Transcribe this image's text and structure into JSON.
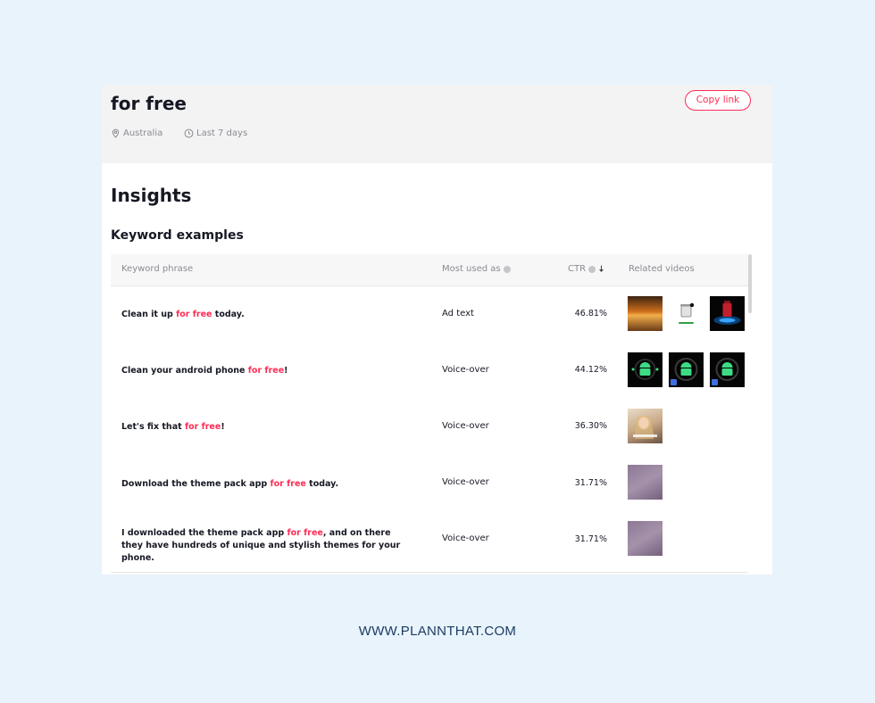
{
  "header": {
    "title": "for free",
    "copy_link_label": "Copy link",
    "location": "Australia",
    "period": "Last 7 days"
  },
  "insights": {
    "title": "Insights",
    "keyword_examples_title": "Keyword examples"
  },
  "table": {
    "columns": {
      "phrase": "Keyword phrase",
      "most_used_as": "Most used as",
      "ctr": "CTR",
      "related_videos": "Related videos"
    },
    "rows": [
      {
        "before": "Clean it up ",
        "highlight": "for free",
        "after": " today.",
        "used_as": "Ad text",
        "ctr": "46.81%",
        "ctr_value": 46.81
      },
      {
        "before": "Clean your android phone ",
        "highlight": "for free",
        "after": "!",
        "used_as": "Voice-over",
        "ctr": "44.12%",
        "ctr_value": 44.12
      },
      {
        "before": "Let's fix that ",
        "highlight": "for free",
        "after": "!",
        "used_as": "Voice-over",
        "ctr": "36.30%",
        "ctr_value": 36.3
      },
      {
        "before": "Download the theme pack app ",
        "highlight": "for free",
        "after": " today.",
        "used_as": "Voice-over",
        "ctr": "31.71%",
        "ctr_value": 31.71
      },
      {
        "before": "I downloaded the theme pack app ",
        "highlight": "for free",
        "after": ", and on there they have hundreds of unique and stylish themes for your phone.",
        "used_as": "Voice-over",
        "ctr": "31.71%",
        "ctr_value": 31.71
      }
    ]
  },
  "footer": {
    "url": "WWW.PLANNTHAT.COM"
  },
  "colors": {
    "accent": "#fe2c55",
    "background": "#e8f3fc",
    "footer_text": "#1d3c63"
  }
}
